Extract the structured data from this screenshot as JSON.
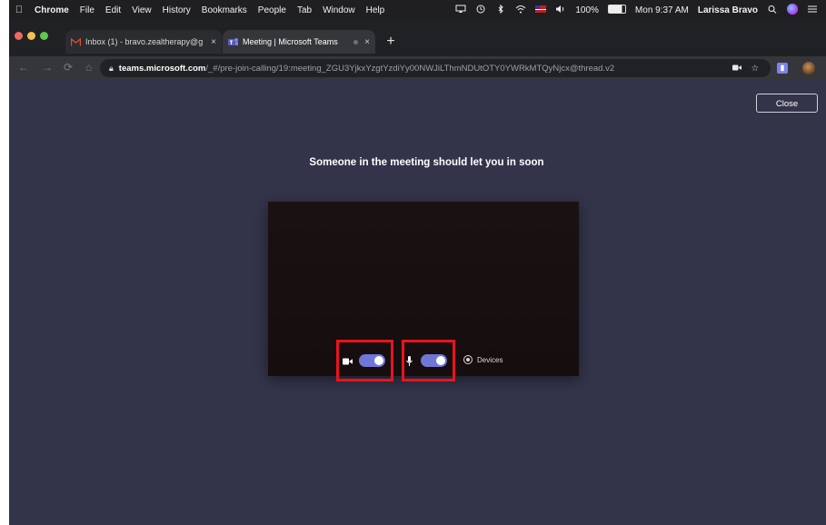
{
  "menubar": {
    "items": [
      "Chrome",
      "File",
      "Edit",
      "View",
      "History",
      "Bookmarks",
      "People",
      "Tab",
      "Window",
      "Help"
    ],
    "battery": "100%",
    "clock": "Mon 9:37 AM",
    "user": "Larissa Bravo"
  },
  "tabs": [
    {
      "title": "Inbox (1) - bravo.zealtherapy@g",
      "close": "×",
      "icon": "gmail-icon"
    },
    {
      "title": "Meeting | Microsoft Teams",
      "close": "×",
      "icon": "teams-icon"
    }
  ],
  "newtab": "+",
  "toolbar": {
    "url_host": "teams.microsoft.com",
    "url_path": "/_#/pre-join-calling/19:meeting_ZGU3YjkxYzgtYzdiYy00NWJiLThmNDUtOTY0YWRkMTQyNjcx@thread.v2"
  },
  "teams": {
    "close_label": "Close",
    "lobby_message": "Someone in the meeting should let you in soon",
    "devices_label": "Devices",
    "camera_on": true,
    "mic_on": true
  },
  "colors": {
    "background": "#33344a",
    "toggle_on": "#6f76d6",
    "highlight": "#e8141d"
  }
}
